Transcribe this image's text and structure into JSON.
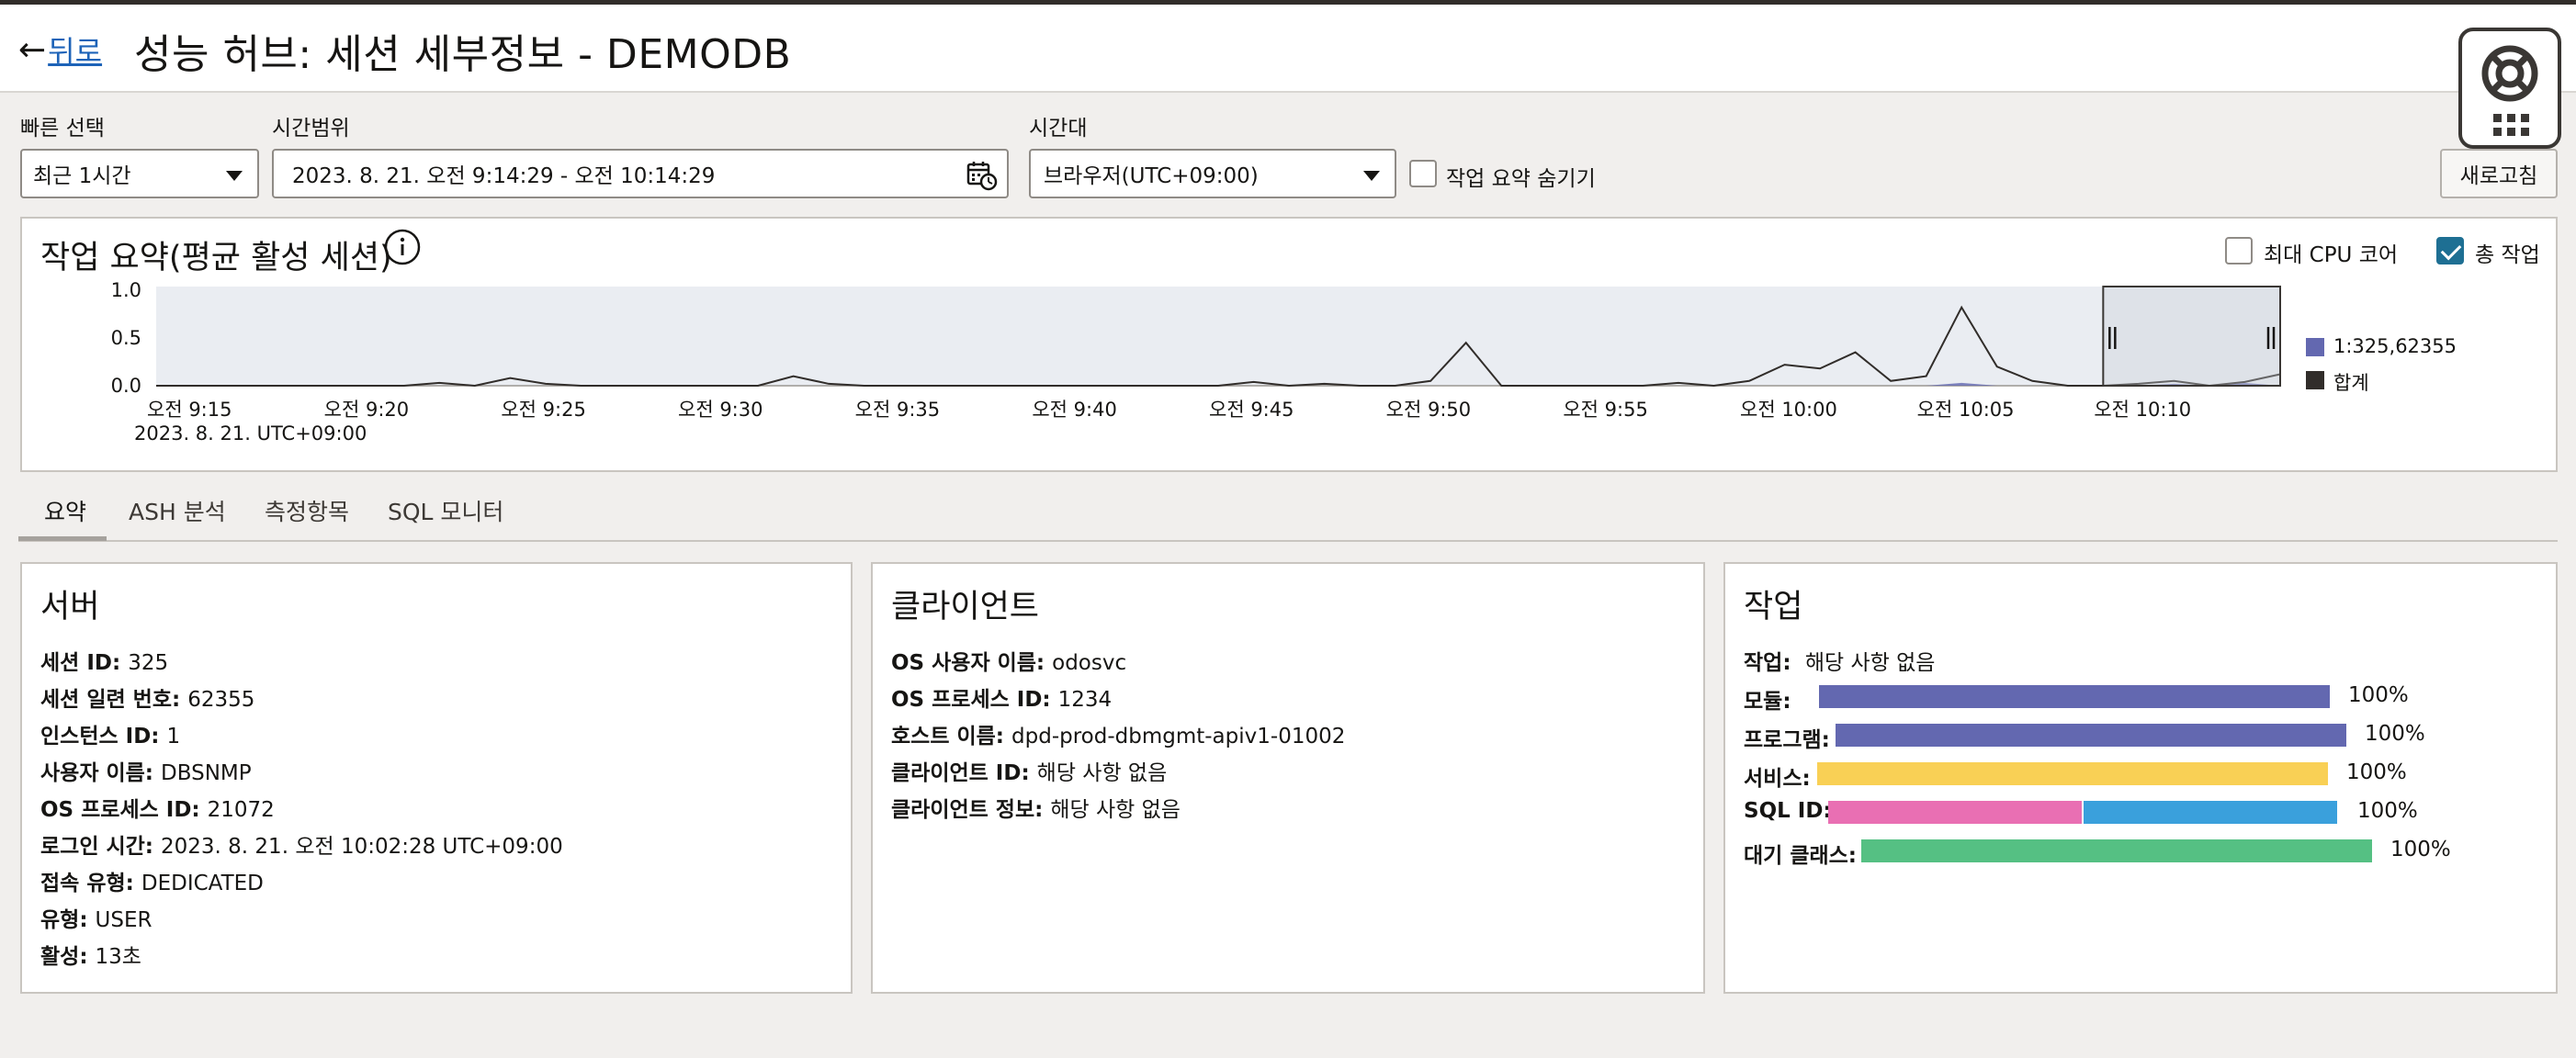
{
  "header": {
    "back_arrow": "←",
    "back_label": "뒤로",
    "title": "성능 허브: 세션 세부정보 - DEMODB"
  },
  "help_widget": {
    "icon": "lifebuoy-icon",
    "grid_icon": "app-grid-icon"
  },
  "filters": {
    "quick_select_label": "빠른 선택",
    "quick_select_value": "최근 1시간",
    "time_range_label": "시간범위",
    "time_range_value": "2023. 8. 21. 오전 9:14:29 - 오전 10:14:29",
    "timezone_label": "시간대",
    "timezone_value": "브라우저(UTC+09:00)",
    "hide_summary_label": "작업 요약 숨기기",
    "hide_summary_checked": false,
    "refresh_label": "새로고침"
  },
  "activity": {
    "title": "작업 요약(평균 활성 세션)",
    "max_cpu_label": "최대 CPU 코어",
    "max_cpu_checked": false,
    "total_label": "총 작업",
    "total_checked": true,
    "date_caption": "2023. 8. 21. UTC+09:00"
  },
  "chart_data": {
    "type": "area",
    "yticks": [
      "1.0",
      "0.5",
      "0.0"
    ],
    "ylim": [
      0,
      1.0
    ],
    "xticks": [
      "오전 9:15",
      "오전 9:20",
      "오전 9:25",
      "오전 9:30",
      "오전 9:35",
      "오전 9:40",
      "오전 9:45",
      "오전 9:50",
      "오전 9:55",
      "오전 10:00",
      "오전 10:05",
      "오전 10:10"
    ],
    "x_minutes": [
      0,
      5,
      10,
      15,
      20,
      25,
      30,
      35,
      40,
      45,
      50,
      55,
      60
    ],
    "series": [
      {
        "name": "1:325,62355",
        "color": "#6368b0",
        "values": [
          0,
          0,
          0,
          0,
          0,
          0,
          0,
          0,
          0,
          0,
          0,
          0,
          0,
          0,
          0,
          0,
          0,
          0,
          0,
          0,
          0,
          0,
          0,
          0,
          0,
          0,
          0,
          0,
          0,
          0,
          0,
          0,
          0,
          0,
          0,
          0,
          0,
          0,
          0,
          0,
          0,
          0,
          0,
          0,
          0,
          0,
          0,
          0,
          0,
          0,
          0,
          0.03,
          0,
          0,
          0,
          0,
          0,
          0.02,
          0,
          0.03,
          0
        ]
      },
      {
        "name": "합계",
        "color": "#312d2a",
        "values": [
          0,
          0,
          0,
          0,
          0,
          0,
          0,
          0,
          0.03,
          0,
          0.08,
          0.02,
          0,
          0,
          0,
          0,
          0,
          0,
          0.1,
          0.02,
          0,
          0,
          0,
          0,
          0,
          0,
          0,
          0,
          0,
          0,
          0,
          0.04,
          0,
          0.02,
          0,
          0,
          0.05,
          0.45,
          0,
          0,
          0,
          0,
          0,
          0.03,
          0,
          0.05,
          0.22,
          0.18,
          0.35,
          0.05,
          0.1,
          0.82,
          0.2,
          0.05,
          0,
          0,
          0.02,
          0.05,
          0,
          0.04,
          0.12
        ]
      }
    ],
    "selection_window_minutes": [
      55,
      60
    ],
    "legend_position": "right"
  },
  "tabs": [
    {
      "label": "요약",
      "active": true
    },
    {
      "label": "ASH 분석",
      "active": false
    },
    {
      "label": "측정항목",
      "active": false
    },
    {
      "label": "SQL 모니터",
      "active": false
    }
  ],
  "server": {
    "title": "서버",
    "fields": [
      {
        "key": "세션 ID:",
        "value": "325"
      },
      {
        "key": "세션 일련 번호:",
        "value": "62355"
      },
      {
        "key": "인스턴스 ID:",
        "value": "1"
      },
      {
        "key": "사용자 이름:",
        "value": "DBSNMP"
      },
      {
        "key": "OS 프로세스 ID:",
        "value": "21072"
      },
      {
        "key": "로그인 시간:",
        "value": "2023. 8. 21. 오전 10:02:28 UTC+09:00"
      },
      {
        "key": "접속 유형:",
        "value": "DEDICATED"
      },
      {
        "key": "유형:",
        "value": "USER"
      },
      {
        "key": "활성:",
        "value": "13초"
      }
    ]
  },
  "client": {
    "title": "클라이언트",
    "fields": [
      {
        "key": "OS 사용자 이름:",
        "value": "odosvc"
      },
      {
        "key": "OS 프로세스 ID:",
        "value": "1234"
      },
      {
        "key": "호스트 이름:",
        "value": "dpd-prod-dbmgmt-apiv1-01002"
      },
      {
        "key": "클라이언트 ID:",
        "value": "해당 사항 없음"
      },
      {
        "key": "클라이언트 정보:",
        "value": "해당 사항 없음"
      }
    ]
  },
  "work": {
    "title": "작업",
    "task_key": "작업:",
    "task_value": "해당 사항 없음",
    "rows": [
      {
        "label": "모듈:",
        "pct": "100%",
        "segments": [
          {
            "fraction": 1.0,
            "color": "#6368b0"
          }
        ]
      },
      {
        "label": "프로그램:",
        "pct": "100%",
        "segments": [
          {
            "fraction": 1.0,
            "color": "#6368b0"
          }
        ]
      },
      {
        "label": "서비스:",
        "pct": "100%",
        "segments": [
          {
            "fraction": 1.0,
            "color": "#f9d055"
          }
        ]
      },
      {
        "label": "SQL ID:",
        "pct": "100%",
        "segments": [
          {
            "fraction": 0.5,
            "color": "#e96fb3"
          },
          {
            "fraction": 0.5,
            "color": "#3aa0dc"
          }
        ]
      },
      {
        "label": "대기 클래스:",
        "pct": "100%",
        "segments": [
          {
            "fraction": 1.0,
            "color": "#55c083"
          }
        ]
      }
    ]
  }
}
